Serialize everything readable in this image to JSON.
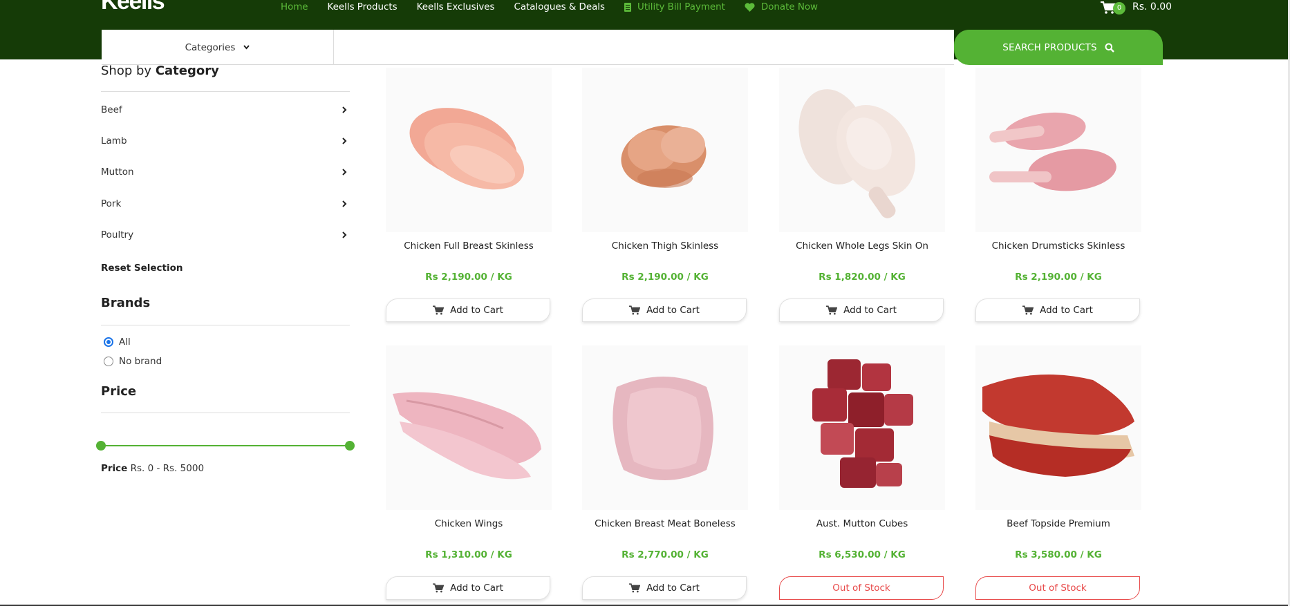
{
  "header": {
    "logo": "Keells",
    "nav": [
      {
        "label": "Home",
        "accent": true,
        "icon": ""
      },
      {
        "label": "Keells Products",
        "accent": false,
        "icon": ""
      },
      {
        "label": "Keells Exclusives",
        "accent": false,
        "icon": ""
      },
      {
        "label": "Catalogues & Deals",
        "accent": false,
        "icon": ""
      },
      {
        "label": "Utility Bill Payment",
        "accent": true,
        "icon": "document-icon"
      },
      {
        "label": "Donate Now",
        "accent": true,
        "icon": "heart-icon"
      }
    ],
    "cart_count": "0",
    "cart_total": "Rs. 0.00",
    "categories_label": "Categories",
    "search_placeholder": "",
    "search_button": "SEARCH PRODUCTS"
  },
  "sidebar": {
    "shop_by": "Shop by",
    "category_word": "Category",
    "categories": [
      "Beef",
      "Lamb",
      "Mutton",
      "Pork",
      "Poultry"
    ],
    "reset": "Reset Selection",
    "brands_title": "Brands",
    "brands": [
      {
        "label": "All",
        "checked": true
      },
      {
        "label": "No brand",
        "checked": false
      }
    ],
    "price_title": "Price",
    "price_word": "Price",
    "price_range": "Rs. 0 - Rs. 5000",
    "price_min_fraction": 0,
    "price_max_fraction": 1
  },
  "products": [
    {
      "name": "Chicken Full Breast Skinless",
      "price": "Rs 2,190.00",
      "unit": "/ KG",
      "button": "Add to Cart",
      "in_stock": true
    },
    {
      "name": "Chicken Thigh Skinless",
      "price": "Rs 2,190.00",
      "unit": "/ KG",
      "button": "Add to Cart",
      "in_stock": true
    },
    {
      "name": "Chicken Whole Legs Skin On",
      "price": "Rs 1,820.00",
      "unit": "/ KG",
      "button": "Add to Cart",
      "in_stock": true
    },
    {
      "name": "Chicken Drumsticks Skinless",
      "price": "Rs 2,190.00",
      "unit": "/ KG",
      "button": "Add to Cart",
      "in_stock": true
    },
    {
      "name": "Chicken Wings",
      "price": "Rs 1,310.00",
      "unit": "/ KG",
      "button": "Add to Cart",
      "in_stock": true
    },
    {
      "name": "Chicken Breast Meat Boneless",
      "price": "Rs 2,770.00",
      "unit": "/ KG",
      "button": "Add to Cart",
      "in_stock": true
    },
    {
      "name": "Aust. Mutton Cubes",
      "price": "Rs 6,530.00",
      "unit": "/ KG",
      "button": "Out of Stock",
      "in_stock": false
    },
    {
      "name": "Beef Topside Premium",
      "price": "Rs 3,580.00",
      "unit": "/ KG",
      "button": "Out of Stock",
      "in_stock": false
    }
  ],
  "colors": {
    "header_bg": "#153b07",
    "accent_green": "#54b234",
    "out_of_stock": "#e84a4a"
  }
}
